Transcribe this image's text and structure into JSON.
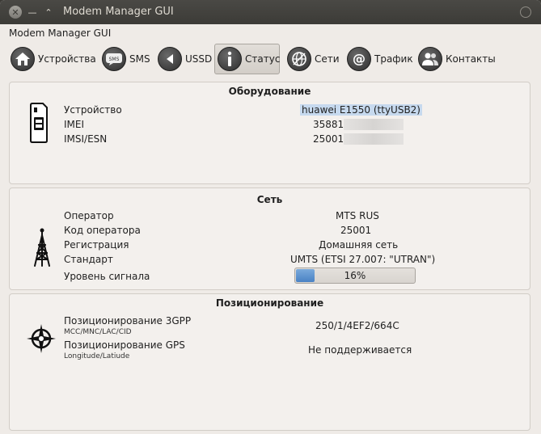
{
  "window": {
    "title": "Modem Manager GUI"
  },
  "app": {
    "title": "Modem Manager GUI"
  },
  "toolbar": {
    "devices": "Устройства",
    "sms": "SMS",
    "ussd": "USSD",
    "status": "Статус",
    "networks": "Сети",
    "traffic": "Трафик",
    "contacts": "Контакты",
    "active": "status",
    "icons": [
      "home-icon",
      "sms-icon",
      "ussd-icon",
      "info-icon",
      "globe-icon",
      "at-icon",
      "contacts-icon"
    ]
  },
  "hardware": {
    "title": "Оборудование",
    "device_label": "Устройство",
    "device_value": "huawei E1550 (ttyUSB2)",
    "imei_label": "IMEI",
    "imei_value": "35881",
    "imsi_label": "IMSI/ESN",
    "imsi_value": "25001"
  },
  "network": {
    "title": "Сеть",
    "operator_label": "Оператор",
    "operator_value": "MTS RUS",
    "code_label": "Код оператора",
    "code_value": "25001",
    "reg_label": "Регистрация",
    "reg_value": "Домашняя сеть",
    "std_label": "Стандарт",
    "std_value": "UMTS (ETSI 27.007: \"UTRAN\")",
    "signal_label": "Уровень сигнала",
    "signal_value": "16%",
    "signal_fraction": 0.16
  },
  "positioning": {
    "title": "Позиционирование",
    "gpp_label": "Позиционирование 3GPP",
    "gpp_sub": "MCC/MNC/LAC/CID",
    "gpp_value": "250/1/4EF2/664C",
    "gps_label": "Позиционирование GPS",
    "gps_sub": "Longitude/Latiude",
    "gps_value": "Не поддерживается"
  }
}
